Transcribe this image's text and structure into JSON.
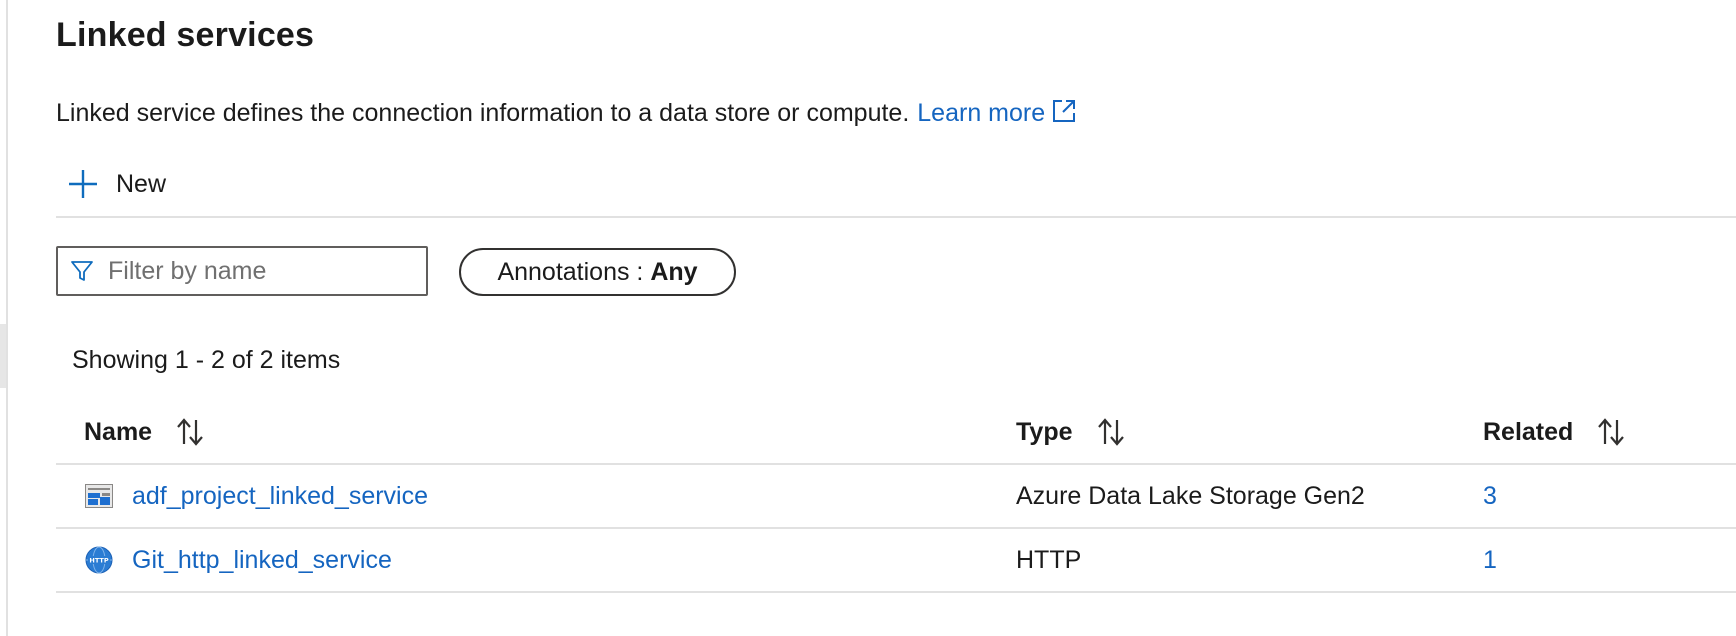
{
  "page": {
    "title": "Linked services",
    "description": "Linked service defines the connection information to a data store or compute.",
    "learn_more_label": "Learn more"
  },
  "toolbar": {
    "new_label": "New"
  },
  "filter": {
    "placeholder": "Filter by name",
    "value": ""
  },
  "annotations": {
    "label": "Annotations : ",
    "value": "Any"
  },
  "list": {
    "showing_text": "Showing 1 - 2 of 2 items",
    "columns": {
      "name": "Name",
      "type": "Type",
      "related": "Related"
    },
    "rows": [
      {
        "name": "adf_project_linked_service",
        "type": "Azure Data Lake Storage Gen2",
        "related": "3",
        "icon": "storage-account-icon"
      },
      {
        "name": "Git_http_linked_service",
        "type": "HTTP",
        "related": "1",
        "icon": "http-globe-icon"
      }
    ]
  },
  "colors": {
    "link": "#1565c0",
    "accent": "#0f6cbd",
    "divider": "#e1e1e1",
    "text": "#1b1b1b"
  }
}
